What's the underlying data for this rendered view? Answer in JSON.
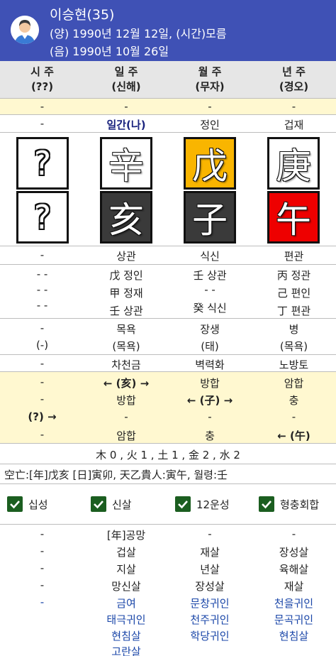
{
  "profile": {
    "name": "이승현(35)",
    "solar": "(양) 1990년 12월 12일, (시간)모름",
    "lunar": "(음) 1990년 10월 26일"
  },
  "columns": [
    {
      "title": "시 주",
      "sub": "(??)"
    },
    {
      "title": "일 주",
      "sub": "(신해)"
    },
    {
      "title": "월 주",
      "sub": "(무자)"
    },
    {
      "title": "년 주",
      "sub": "(경오)"
    }
  ],
  "dash": "-",
  "sipsin_top": [
    "-",
    "일간(나)",
    "정인",
    "겁재"
  ],
  "stems": [
    "?",
    "辛",
    "戊",
    "庚"
  ],
  "branches": [
    "?",
    "亥",
    "子",
    "午"
  ],
  "sipsin_bottom": [
    "-",
    "상관",
    "식신",
    "편관"
  ],
  "jijanggan": [
    [
      "- -",
      "- -",
      "- -"
    ],
    [
      "戊 정인",
      "甲 정재",
      "壬 상관"
    ],
    [
      "壬 상관",
      "- -",
      "癸 식신"
    ],
    [
      "丙 정관",
      "己 편인",
      "丁 편관"
    ]
  ],
  "unseong": [
    [
      "-",
      "(-)"
    ],
    [
      "목욕",
      "(목욕)"
    ],
    [
      "장생",
      "(태)"
    ],
    [
      "병",
      "(목욕)"
    ]
  ],
  "napeum": [
    "-",
    "차천금",
    "벽력화",
    "노방토"
  ],
  "relations": [
    [
      "-",
      "-",
      "(?) →",
      "-"
    ],
    [
      "← (亥) →",
      "방합",
      "-",
      "암합"
    ],
    [
      "방합",
      "← (子) →",
      "-",
      "충"
    ],
    [
      "암합",
      "충",
      "-",
      "← (午)"
    ]
  ],
  "elements": "木 0 , 火 1 , 土 1 , 金 2 , 水 2",
  "gongmang": "空亡:[年]戊亥 [日]寅卯, 天乙貴人:寅午, 월령:壬",
  "checkboxes": [
    "십성",
    "신살",
    "12운성",
    "형충회합"
  ],
  "sinsal": [
    [
      "-",
      "-",
      "-",
      "-",
      "-"
    ],
    [
      "[年]공망",
      "겁살",
      "지살",
      "망신살",
      "금여",
      "태극귀인",
      "현침살",
      "고란살"
    ],
    [
      "-",
      "재살",
      "년살",
      "장성살",
      "문창귀인",
      "천주귀인",
      "학당귀인"
    ],
    [
      "-",
      "장성살",
      "육해살",
      "재살",
      "천을귀인",
      "문곡귀인",
      "현침살"
    ]
  ]
}
